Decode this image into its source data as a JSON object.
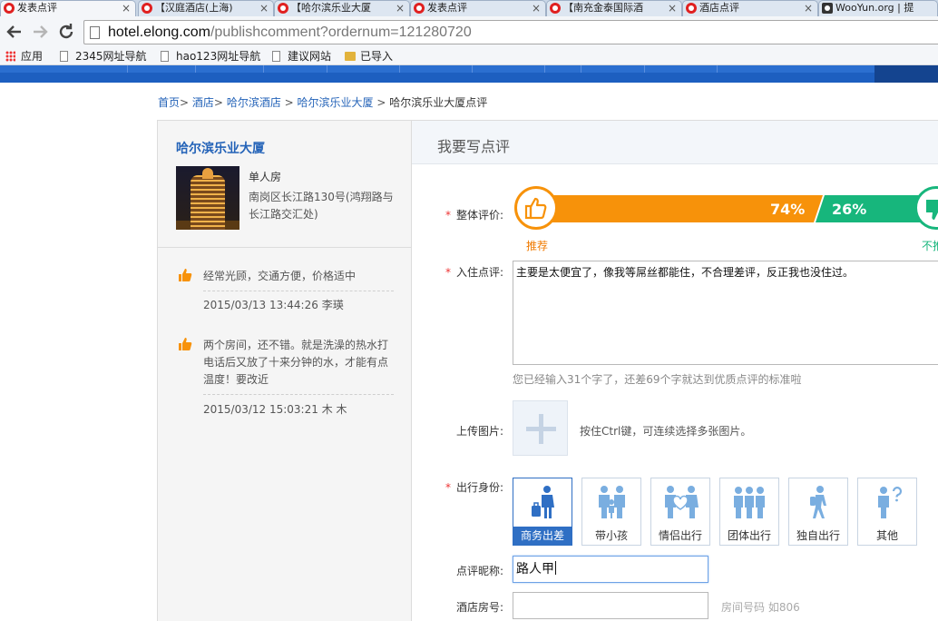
{
  "browser": {
    "tabs": [
      {
        "title": "发表点评",
        "active": true,
        "icon": "elong-favicon"
      },
      {
        "title": "【汉庭酒店(上海)",
        "active": false,
        "icon": "elong-favicon"
      },
      {
        "title": "【哈尔滨乐业大厦",
        "active": false,
        "icon": "elong-favicon"
      },
      {
        "title": "发表点评",
        "active": false,
        "icon": "elong-favicon"
      },
      {
        "title": "【南充金泰国际酒",
        "active": false,
        "icon": "elong-favicon"
      },
      {
        "title": "酒店点评",
        "active": false,
        "icon": "elong-favicon"
      },
      {
        "title": "WooYun.org | 提",
        "active": false,
        "icon": "wooyun-favicon"
      }
    ],
    "tab_close_glyph": "×",
    "url_host": "hotel.elong.com",
    "url_path": "/publishcomment?ordernum=121280720",
    "bookmarks": [
      {
        "label": "应用",
        "icon": "apps-grid-icon"
      },
      {
        "label": "2345网址导航",
        "icon": "page-icon"
      },
      {
        "label": "hao123网址导航",
        "icon": "page-icon"
      },
      {
        "label": "建议网站",
        "icon": "page-icon"
      },
      {
        "label": "已导入",
        "icon": "folder-icon"
      }
    ]
  },
  "breadcrumb": {
    "items": [
      "首页",
      "酒店",
      "哈尔滨酒店",
      "哈尔滨乐业大厦"
    ],
    "current": "哈尔滨乐业大厦点评",
    "sep": ">"
  },
  "hotel": {
    "name": "哈尔滨乐业大厦",
    "room_type": "单人房",
    "address": "南岗区长江路130号(鸿翔路与长江路交汇处)"
  },
  "reviews": [
    {
      "text": "经常光顾，交通方便，价格适中",
      "date": "2015/03/13 13:44:26",
      "author": "李瑛"
    },
    {
      "text": "两个房间，还不错。就是洗澡的热水打电话后又放了十来分钟的水，才能有点温度！要改近",
      "date": "2015/03/12 15:03:21",
      "author": "木 木"
    }
  ],
  "form": {
    "title": "我要写点评",
    "required_mark": "*",
    "overall_label": "整体评价:",
    "recommend_pct": 74,
    "recommend_pct_label": "74%",
    "not_recommend_pct_label": "26%",
    "recommend_caption": "推荐",
    "not_recommend_caption": "不推",
    "review_label": "入住点评:",
    "review_value": "主要是太便宜了，像我等屌丝都能住，不合理差评，反正我也没住过。",
    "review_hint": "您已经输入31个字了，还差69个字就达到优质点评的标准啦",
    "upload_label": "上传图片:",
    "upload_hint": "按住Ctrl键，可连续选择多张图片。",
    "identity_label": "出行身份:",
    "identities": [
      {
        "label": "商务出差",
        "selected": true
      },
      {
        "label": "带小孩",
        "selected": false
      },
      {
        "label": "情侣出行",
        "selected": false
      },
      {
        "label": "团体出行",
        "selected": false
      },
      {
        "label": "独自出行",
        "selected": false
      },
      {
        "label": "其他",
        "selected": false
      }
    ],
    "nickname_label": "点评昵称:",
    "nickname_value": "路人甲",
    "room_label": "酒店房号:",
    "room_value": "",
    "room_hint": "房间号码 如806"
  },
  "colors": {
    "link": "#2463b8",
    "recommend": "#f7920a",
    "not_recommend": "#17b67c",
    "site_nav": "#1d5fc0",
    "identity_icon": "#7aaee0",
    "selected": "#2f6fc4"
  }
}
